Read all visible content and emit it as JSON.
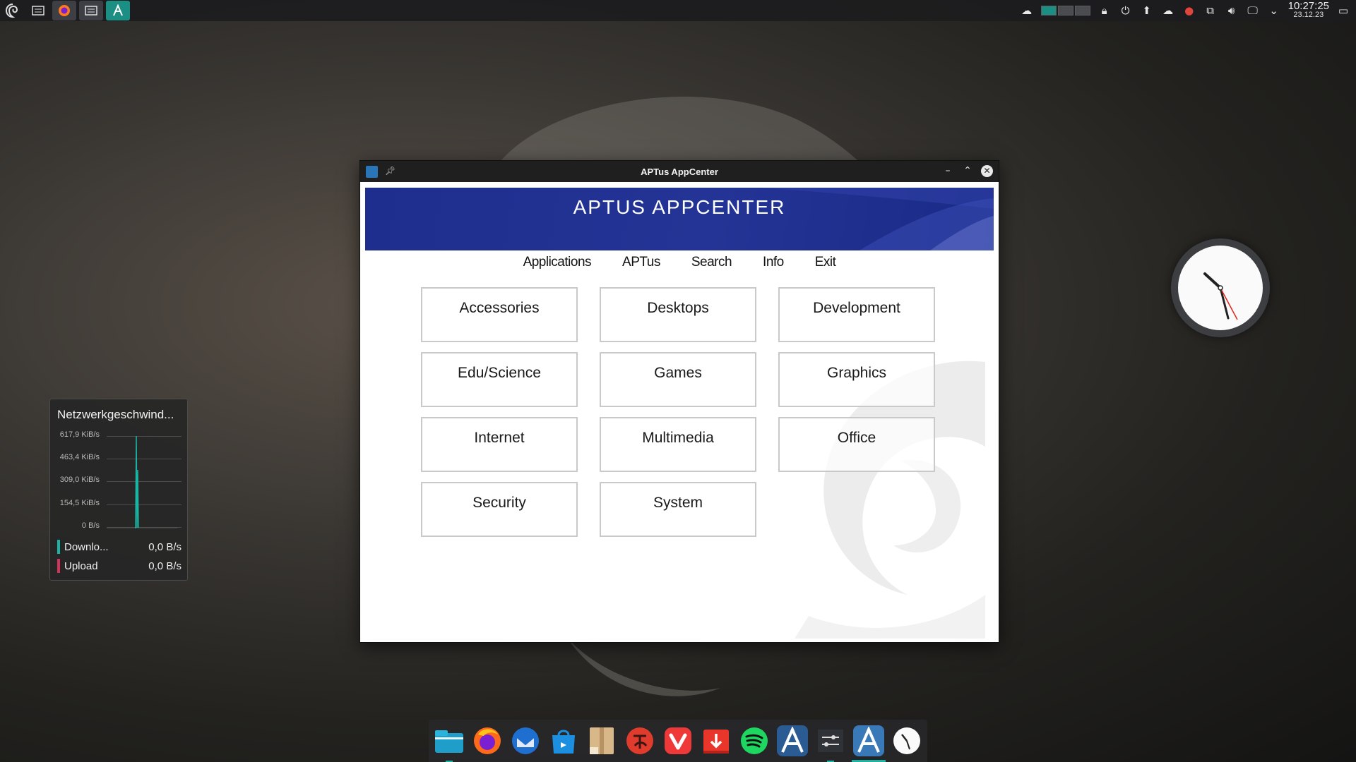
{
  "top_panel": {
    "clock_time": "10:27:25",
    "clock_date": "23.12.23"
  },
  "network_widget": {
    "title": "Netzwerkgeschwind...",
    "axis": [
      "617,9 KiB/s",
      "463,4 KiB/s",
      "309,0 KiB/s",
      "154,5 KiB/s",
      "0 B/s"
    ],
    "download_label": "Downlo...",
    "download_value": "0,0 B/s",
    "upload_label": "Upload",
    "upload_value": "0,0 B/s",
    "download_color": "#1bb3a3",
    "upload_color": "#d2335a"
  },
  "window": {
    "title": "APTus AppCenter",
    "banner_title": "APTUS APPCENTER",
    "menu": [
      "Applications",
      "APTus",
      "Search",
      "Info",
      "Exit"
    ],
    "categories": [
      "Accessories",
      "Desktops",
      "Development",
      "Edu/Science",
      "Games",
      "Graphics",
      "Internet",
      "Multimedia",
      "Office",
      "Security",
      "System"
    ]
  },
  "dock": {
    "items": [
      "file-manager-icon",
      "firefox-icon",
      "thunderbird-icon",
      "software-store-icon",
      "archive-icon",
      "debian-tool-icon",
      "vivaldi-icon",
      "downloader-icon",
      "spotify-icon",
      "aptus-icon",
      "settings-icon",
      "aptus-appcenter-icon",
      "clock-icon"
    ]
  },
  "colors": {
    "accent": "#1b8f84",
    "banner": "#1d2e8e"
  }
}
